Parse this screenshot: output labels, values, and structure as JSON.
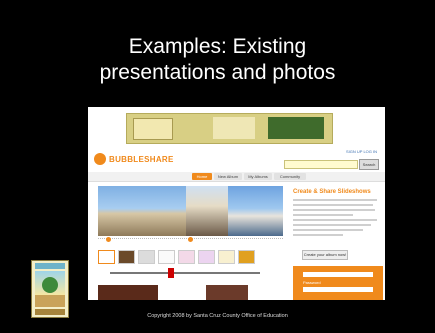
{
  "slide": {
    "title_line1": "Examples: Existing",
    "title_line2": "presentations and photos",
    "copyright": "Copyright 2008 by Santa Cruz County Office of Education"
  },
  "site": {
    "logo_text": "BUBBLESHARE",
    "top_link": "SIGN UP  LOG IN",
    "search_button": "Search",
    "nav_tabs": [
      "Home",
      "New Album",
      "My Albums",
      "Community"
    ],
    "side_title": "Create & Share Slideshows",
    "side_button": "Create your album now!",
    "login_label1": "Email",
    "login_label2": "Password"
  },
  "colors": {
    "accent": "#f08a1c",
    "background": "#000000"
  }
}
